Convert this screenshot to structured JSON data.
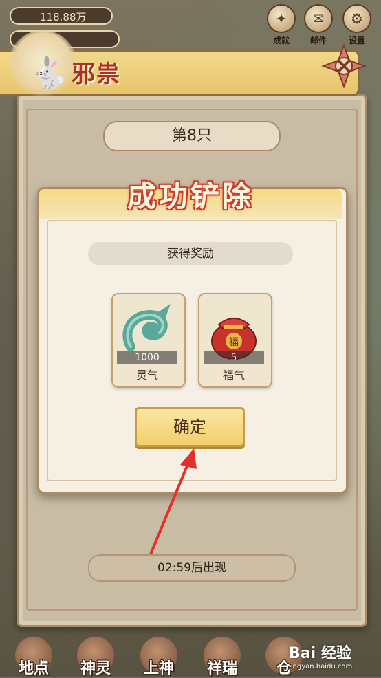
{
  "topbar": {
    "resource_1": "118.88万",
    "icons": [
      {
        "label": "成就",
        "icon": "achievement-icon"
      },
      {
        "label": "邮件",
        "icon": "mail-icon"
      },
      {
        "label": "设置",
        "icon": "gear-icon"
      }
    ]
  },
  "panel": {
    "title": "邪祟",
    "counter": "第8只",
    "timer": "02:59后出现"
  },
  "modal": {
    "title": "成功铲除",
    "reward_header": "获得奖励",
    "rewards": [
      {
        "count": "1000",
        "label": "灵气",
        "icon": "jade-icon"
      },
      {
        "count": "5",
        "label": "福气",
        "icon": "lucky-bag-icon"
      }
    ],
    "confirm_label": "确定"
  },
  "bottom_nav": [
    {
      "label": "地点"
    },
    {
      "label": "神灵"
    },
    {
      "label": "上神"
    },
    {
      "label": "祥瑞"
    },
    {
      "label": "仓"
    }
  ],
  "watermark": {
    "main": "Bai 经验",
    "sub": "jingyan.baidu.com"
  },
  "colors": {
    "accent_red": "#c9382b",
    "gold": "#f2cf6c",
    "panel": "#c9bca4"
  }
}
